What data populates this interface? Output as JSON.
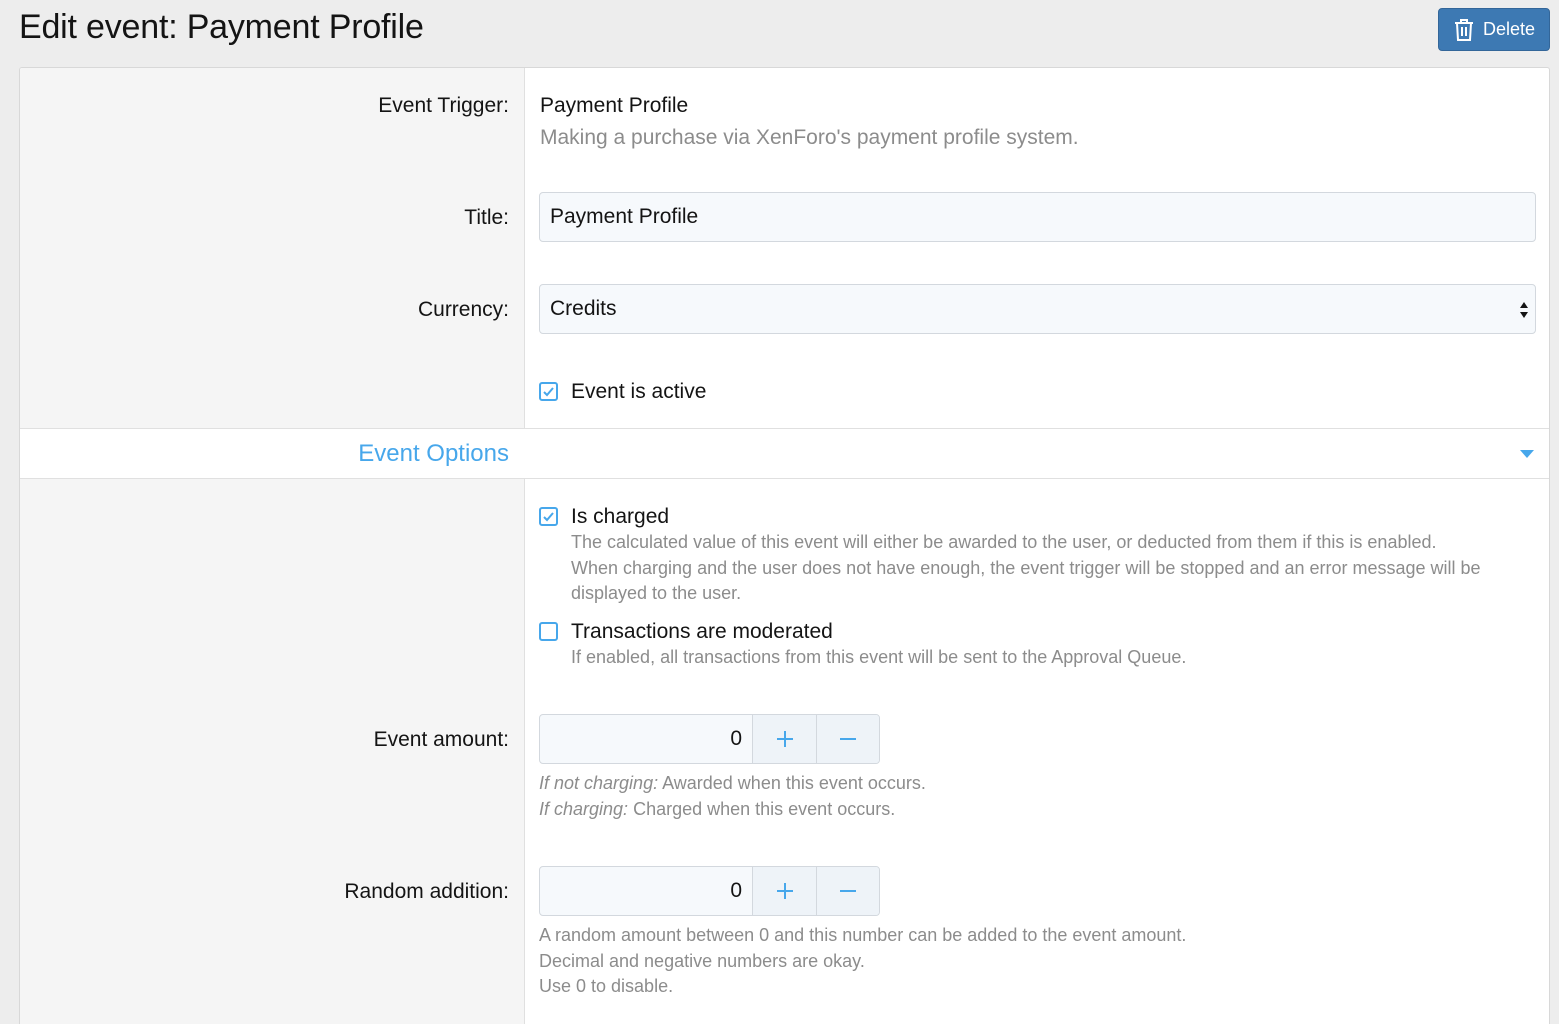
{
  "page": {
    "title": "Edit event: Payment Profile",
    "delete_label": "Delete"
  },
  "trigger": {
    "label": "Event Trigger:",
    "name": "Payment Profile",
    "description": "Making a purchase via XenForo's payment profile system."
  },
  "title_field": {
    "label": "Title:",
    "value": "Payment Profile"
  },
  "currency": {
    "label": "Currency:",
    "selected": "Credits"
  },
  "active": {
    "label": "Event is active",
    "checked": true
  },
  "section": {
    "title": "Event Options"
  },
  "is_charged": {
    "label": "Is charged",
    "checked": true,
    "hint1": "The calculated value of this event will either be awarded to the user, or deducted from them if this is enabled.",
    "hint2": "When charging and the user does not have enough, the event trigger will be stopped and an error message will be",
    "hint3": "displayed to the user."
  },
  "moderated": {
    "label": "Transactions are moderated",
    "checked": false,
    "hint": "If enabled, all transactions from this event will be sent to the Approval Queue."
  },
  "event_amount": {
    "label": "Event amount:",
    "value": "0",
    "hint1_em": "If not charging:",
    "hint1": " Awarded when this event occurs.",
    "hint2_em": "If charging:",
    "hint2": " Charged when this event occurs."
  },
  "random_addition": {
    "label": "Random addition:",
    "value": "0",
    "hint1": "A random amount between 0 and this number can be added to the event amount.",
    "hint2": "Decimal and negative numbers are okay.",
    "hint3": "Use 0 to disable."
  },
  "colors": {
    "accent": "#47a7eb",
    "button": "#3d79b3"
  },
  "icons": {
    "delete": "trash-icon",
    "check": "check-icon",
    "plus": "plus-icon",
    "minus": "minus-icon",
    "select": "select-arrows-icon",
    "caret": "caret-down-icon"
  }
}
